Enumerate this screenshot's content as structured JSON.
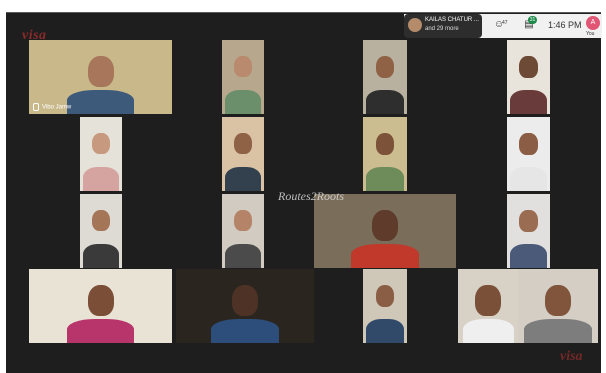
{
  "header": {
    "logo_text": "visa",
    "participants_line1": "KAILAS CHATUR ...",
    "participants_line2": "and 29 more",
    "people_count": "47",
    "chat_badge": "31",
    "time": "1:46 PM",
    "you_initial": "A",
    "you_label": "You"
  },
  "grid": {
    "tiles": [
      {
        "name": "Vibo Jamw",
        "skin": "#a8765a",
        "shirt": "#3d5a7a",
        "bg": "#c9b98a"
      },
      {
        "name": "",
        "skin": "#b98a6d",
        "shirt": "#6b8f6a",
        "bg": "#b7a78d"
      },
      {
        "name": "",
        "skin": "#8f6246",
        "shirt": "#2e2e2e",
        "bg": "#b9b1a0"
      },
      {
        "name": "",
        "skin": "#6d4a35",
        "shirt": "#6a3b3b",
        "bg": "#e8e4dc"
      },
      {
        "name": "",
        "skin": "#c79a80",
        "shirt": "#d5a4a0",
        "bg": "#e5e2d9"
      },
      {
        "name": "",
        "skin": "#8f6246",
        "shirt": "#33404e",
        "bg": "#d9c3a4"
      },
      {
        "name": "",
        "skin": "#7c5238",
        "shirt": "#6e8b5a",
        "bg": "#cbbd8f"
      },
      {
        "name": "",
        "skin": "#8b5d44",
        "shirt": "#e6e6e6",
        "bg": "#ececec"
      },
      {
        "name": "",
        "skin": "#a57558",
        "shirt": "#3a3a3a",
        "bg": "#dedbd5"
      },
      {
        "name": "",
        "skin": "#b58468",
        "shirt": "#4b4b4b",
        "bg": "#d1cbc2"
      },
      {
        "name": "",
        "skin": "#5e3b2a",
        "shirt": "#c0392b",
        "bg": "#7a6e5a"
      },
      {
        "name": "",
        "skin": "#9a6c52",
        "shirt": "#4a5a78",
        "bg": "#e2e0df"
      },
      {
        "name": "",
        "skin": "#7b4f37",
        "shirt": "#b8356b",
        "bg": "#e9e3d6"
      },
      {
        "name": "",
        "skin": "#4d3225",
        "shirt": "#2d4d7a",
        "bg": "#2b2520"
      },
      {
        "name": "",
        "skin": "#8a5e44",
        "shirt": "#324a6a",
        "bg": "#cfc7b8"
      },
      {
        "name": "",
        "skin": "#7a5038",
        "shirt": "#efefef",
        "bg": "#d8d2c6"
      },
      {
        "name": "",
        "skin": "#80553c",
        "shirt": "#7d7d7d",
        "bg": "#d5cec4"
      }
    ]
  },
  "watermark": "Routes2Roots",
  "footer_logo": "visa"
}
